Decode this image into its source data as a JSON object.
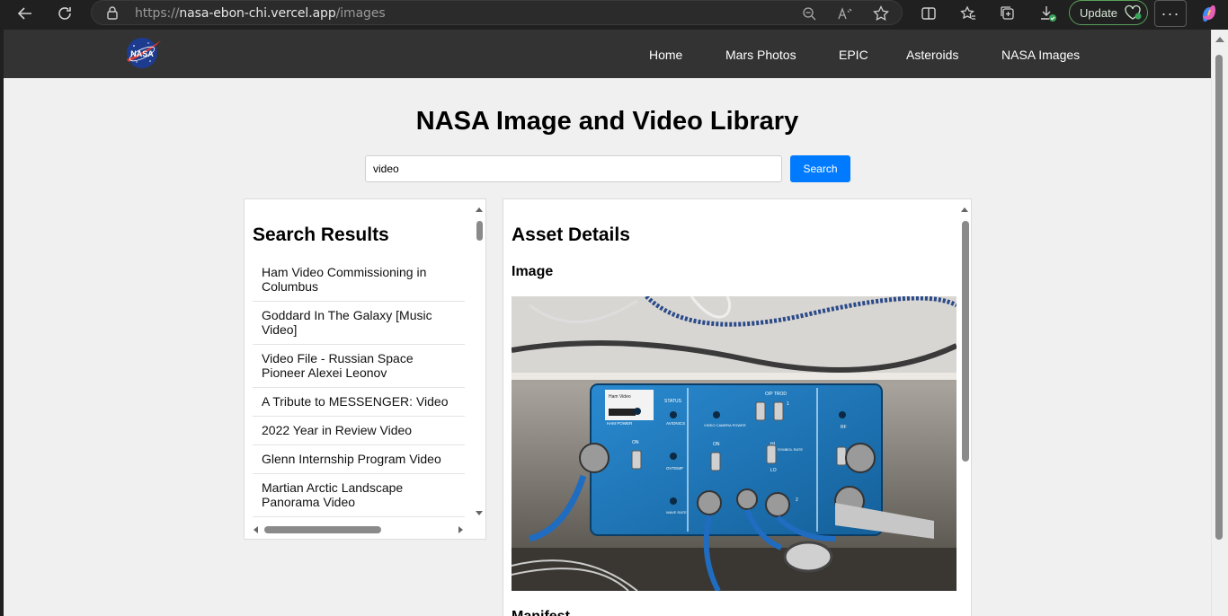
{
  "browser": {
    "url_scheme": "https://",
    "url_host": "nasa-ebon-chi.vercel.app",
    "url_path": "/images",
    "update_label": "Update",
    "more_label": "···"
  },
  "nav": {
    "logo_text": "NASA",
    "links": [
      "Home",
      "Mars Photos",
      "EPIC",
      "Asteroids",
      "NASA Images"
    ]
  },
  "page": {
    "title": "NASA Image and Video Library",
    "search_value": "video",
    "search_button": "Search"
  },
  "results": {
    "heading": "Search Results",
    "items": [
      "Ham Video Commissioning in Columbus",
      "Goddard In The Galaxy [Music Video]",
      "Video File - Russian Space Pioneer Alexei Leonov",
      "A Tribute to MESSENGER: Video",
      "2022 Year in Review Video",
      "Glenn Internship Program Video",
      "Martian Arctic Landscape Panorama Video"
    ]
  },
  "details": {
    "heading": "Asset Details",
    "image_heading": "Image",
    "metadata_heading": "Manifest",
    "panel_labels": {
      "title_tag": "Ham Video",
      "status": "STATUS",
      "output": "O/P TROD",
      "ham_power": "HAM POWER",
      "avionics": "AVIONICS",
      "video_camera_power": "VIDEO CAMERA POWER",
      "video_in": "VIDEO IN",
      "symbol_rate": "SYMBOL RATE",
      "wave_rate": "WAVE RATE",
      "ovtemp": "OVTEMP",
      "on": "ON",
      "hi": "HI",
      "lo": "LO",
      "rf": "RF",
      "one": "1",
      "two": "2"
    }
  },
  "colors": {
    "nav_bg": "#333333",
    "page_bg": "#f0f0f0",
    "button": "#007bff",
    "panel_blue": "#1e78b8"
  }
}
